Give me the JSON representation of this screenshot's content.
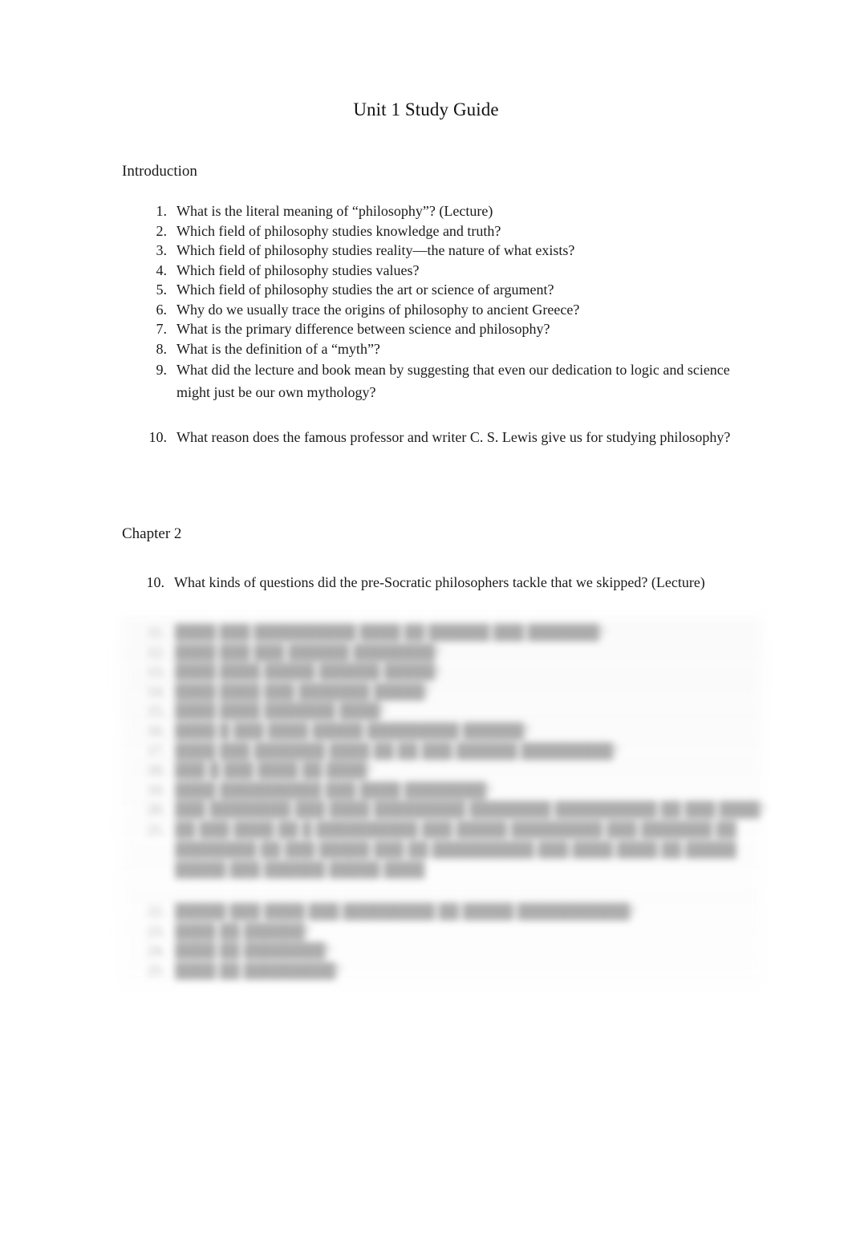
{
  "document": {
    "title": "Unit 1 Study Guide"
  },
  "sections": [
    {
      "heading": "Introduction",
      "items": [
        {
          "number": "1.",
          "text": "What is the literal meaning of “philosophy”?     (Lecture)"
        },
        {
          "number": "2.",
          "text": "Which field of philosophy studies knowledge and truth?"
        },
        {
          "number": "3.",
          "text": "Which field of philosophy studies reality—the nature of what exists?"
        },
        {
          "number": "4.",
          "text": "Which field of philosophy studies values?"
        },
        {
          "number": "5.",
          "text": "Which field of philosophy studies the art or science of argument?"
        },
        {
          "number": "6.",
          "text": "Why do we usually trace the origins of philosophy to ancient Greece?"
        },
        {
          "number": "7.",
          "text": "What is the primary difference between science and philosophy?"
        },
        {
          "number": "8.",
          "text": "What is the definition of a “myth”?"
        },
        {
          "number": "9.",
          "text": "What did the lecture and book mean by suggesting that even our dedication to logic and science might just be our own mythology?"
        },
        {
          "number": "10.",
          "text": "What reason does the famous professor and writer C. S. Lewis give us for studying philosophy?"
        }
      ]
    },
    {
      "heading": "Chapter 2",
      "items": [
        {
          "number": "10.",
          "text": "What kinds of questions did the pre-Socratic philosophers tackle that we skipped?   (Lecture)"
        }
      ],
      "redacted_note": "blurred illegible question list",
      "redacted_rows": [
        {
          "number": "11.",
          "text": "████ ███ ██████████ ████ ██ ██████ ███ ███████?"
        },
        {
          "number": "12.",
          "text": "████ ███ ███  ██████  ████████?"
        },
        {
          "number": "13.",
          "text": "████ ████  █████ ██████  █████?"
        },
        {
          "number": "14.",
          "text": "████ ████  ███ ███████  █████?"
        },
        {
          "number": "15.",
          "text": "████ ████  ███████  ████?"
        },
        {
          "number": "16.",
          "text": "████ █  ███ ████ █████ █████████ ██████?"
        },
        {
          "number": "17.",
          "text": "████ ███ ███████  ████ ██ ██ ███ ██████ █████████?"
        },
        {
          "number": "18.",
          "text": "███  █ ███ ████ ██ ████?"
        },
        {
          "number": "19.",
          "text": "████ ██████████ ███ ████ ████████?"
        },
        {
          "number": "20.",
          "text": "███ ████████ ███ ████ █████████ ████████ ██████████ ██ ███ ████?"
        },
        {
          "number": "21.",
          "text": "██ ███ ████ ██ █ ██████████ ███ █████ █████████ ███ ███████ ██ ████████ ██ ███ █████ ███ ██ ██████████ ███ ████ ████ ██ █████ █████ ███ ██████ █████ ████"
        },
        {
          "number": "22.",
          "text": "█████ ███ ████  ███ █████████ ██ █████ ███████████?"
        },
        {
          "number": "23.",
          "text": "████ ██ ██████?"
        },
        {
          "number": "24.",
          "text": "████ ██ ████████?"
        },
        {
          "number": "25.",
          "text": "████ ██ █████████?"
        }
      ]
    }
  ]
}
